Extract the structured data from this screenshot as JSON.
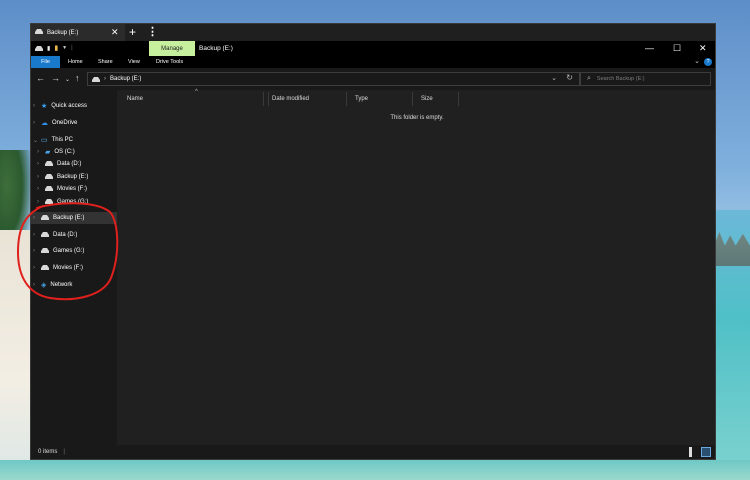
{
  "window": {
    "tab_title": "Backup (E:)",
    "title": "Backup (E:)",
    "manage_label": "Manage"
  },
  "ribbon": {
    "tabs": [
      "File",
      "Home",
      "Share",
      "View",
      "Drive Tools"
    ]
  },
  "address": {
    "path": "Backup (E:)"
  },
  "search": {
    "placeholder": "Search Backup (E:)"
  },
  "nav": {
    "quick_access": "Quick access",
    "onedrive": "OneDrive",
    "this_pc": "This PC",
    "pc_drives": [
      "OS (C:)",
      "Data (D:)",
      "Backup (E:)",
      "Movies (F:)",
      "Games (G:)"
    ],
    "root_drives": [
      "Backup (E:)",
      "Data (D:)",
      "Games (G:)",
      "Movies (F:)"
    ],
    "network": "Network"
  },
  "columns": [
    "Name",
    "Date modified",
    "Type",
    "Size"
  ],
  "empty_message": "This folder is empty.",
  "status": {
    "items": "0 items"
  },
  "colors": {
    "accent": "#1979ca",
    "manage_bg": "#c6ef9e",
    "annotation": "#e0201c"
  }
}
